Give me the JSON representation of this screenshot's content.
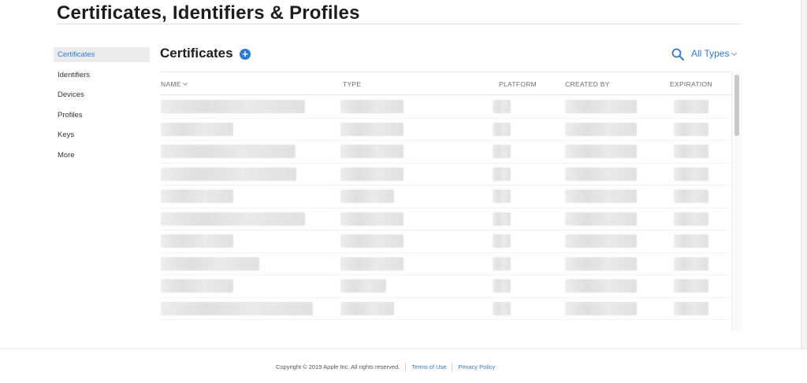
{
  "page": {
    "title": "Certificates, Identifiers & Profiles"
  },
  "sidebar": {
    "items": [
      {
        "label": "Certificates"
      },
      {
        "label": "Identifiers"
      },
      {
        "label": "Devices"
      },
      {
        "label": "Profiles"
      },
      {
        "label": "Keys"
      },
      {
        "label": "More"
      }
    ]
  },
  "section": {
    "title": "Certificates",
    "add_symbol": "+"
  },
  "filter": {
    "label": "All Types"
  },
  "table": {
    "columns": [
      "NAME",
      "TYPE",
      "PLATFORM",
      "CREATED BY",
      "EXPIRATION"
    ]
  },
  "footer": {
    "copyright": "Copyright © 2019 Apple Inc. All rights reserved.",
    "terms": "Terms of Use",
    "privacy": "Privacy Policy"
  },
  "colors": {
    "accent": "#2d7bd6",
    "active_bg": "#ececec"
  }
}
